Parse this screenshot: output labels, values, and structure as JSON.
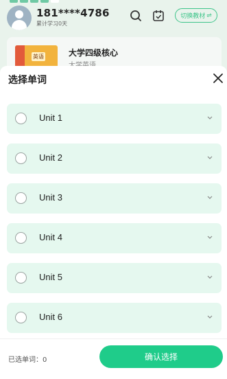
{
  "header": {
    "phone": "181****4786",
    "study_days": "累计学习0天",
    "switch_label": "切换教材",
    "switch_icon": "⇌",
    "search_icon": "search-icon",
    "calendar_icon": "calendar-icon"
  },
  "book": {
    "title": "大学四级核心",
    "subtitle": "大学英语",
    "cover_label": "英语"
  },
  "sheet": {
    "title": "选择单词",
    "close_icon": "close-icon",
    "units": [
      {
        "label": "Unit 1"
      },
      {
        "label": "Unit 2"
      },
      {
        "label": "Unit 3"
      },
      {
        "label": "Unit 4"
      },
      {
        "label": "Unit 5"
      },
      {
        "label": "Unit 6"
      }
    ],
    "selected_label": "已选单词：0",
    "confirm_label": "确认选择"
  },
  "colors": {
    "accent": "#1fcc8a",
    "unit_bg": "#e5f8ef"
  }
}
